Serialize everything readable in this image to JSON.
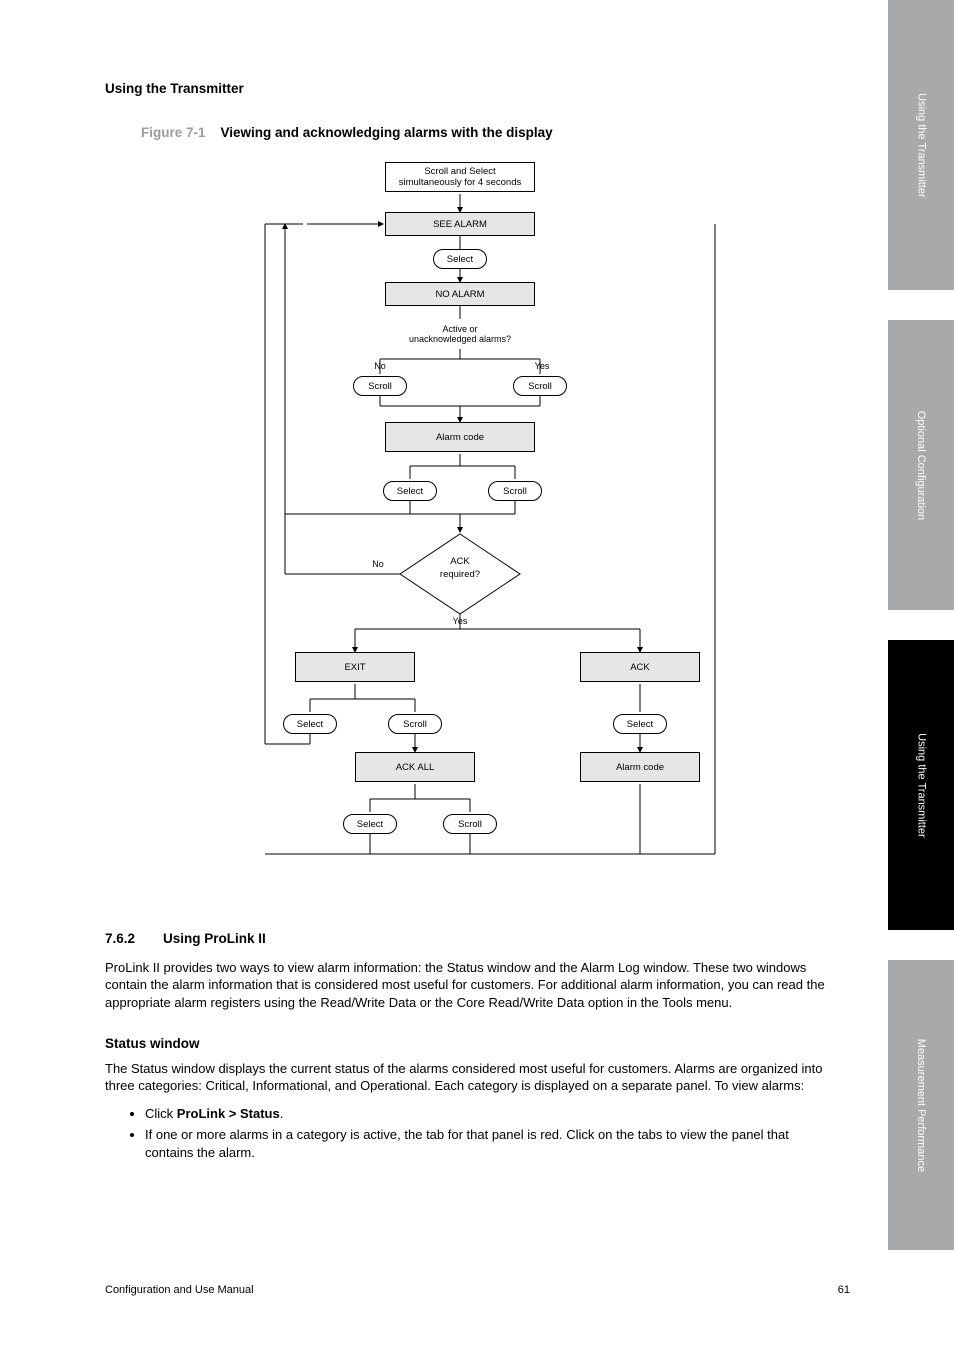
{
  "running_head": "Using the Transmitter",
  "figure": {
    "number": "Figure 7-1",
    "title": "Viewing and acknowledging alarms with the display"
  },
  "flow": {
    "start": "Scroll and Select\nsimultaneously for 4 seconds",
    "see_alarm": "SEE ALARM",
    "select1": "Select",
    "no_alarm": "NO ALARM",
    "alarm_active_q": "Active or\nunacknowledged alarms?",
    "no1": "No",
    "scroll_left": "Scroll",
    "yes1": "Yes",
    "scroll_r1": "Scroll",
    "alarm_code": "Alarm code",
    "select2": "Select",
    "scroll2": "Scroll",
    "ack_q": "ACK\nrequired?",
    "no2": "No",
    "yes2": "Yes",
    "exit": "EXIT",
    "ack": "ACK",
    "select3": "Select",
    "scroll3": "Scroll",
    "select4": "Select",
    "ack_all": "ACK ALL",
    "select5": "Select",
    "scroll5": "Scroll"
  },
  "section_762": {
    "num": "7.6.2",
    "title": "Using ProLink II",
    "p1": "ProLink II provides two ways to view alarm information: the Status window and the Alarm Log window. These two windows contain the alarm information that is considered most useful for customers. For additional alarm information, you can read the appropriate alarm registers using the Read/Write Data or the Core Read/Write Data option in the Tools menu.",
    "run_in": "Status window",
    "p2_pre": "The Status window displays the current status of the alarms considered most useful for customers. Alarms are organized into three categories: Critical, Informational, and Operational. Each category is displayed on a separate panel. To view alarms:",
    "b1_pre": "Click ",
    "b1_strong": "ProLink > Status",
    "b1_post": ".",
    "b2": "If one or more alarms in a category is active, the tab for that panel is red. Click on the tabs to view the panel that contains the alarm."
  },
  "tabs": {
    "t1": "Using the Transmitter",
    "t2": "Optional Configuration",
    "t3": "Using the Transmitter",
    "t4": "Measurement Performance"
  },
  "footer": {
    "left": "Configuration and Use Manual",
    "right": "61"
  }
}
